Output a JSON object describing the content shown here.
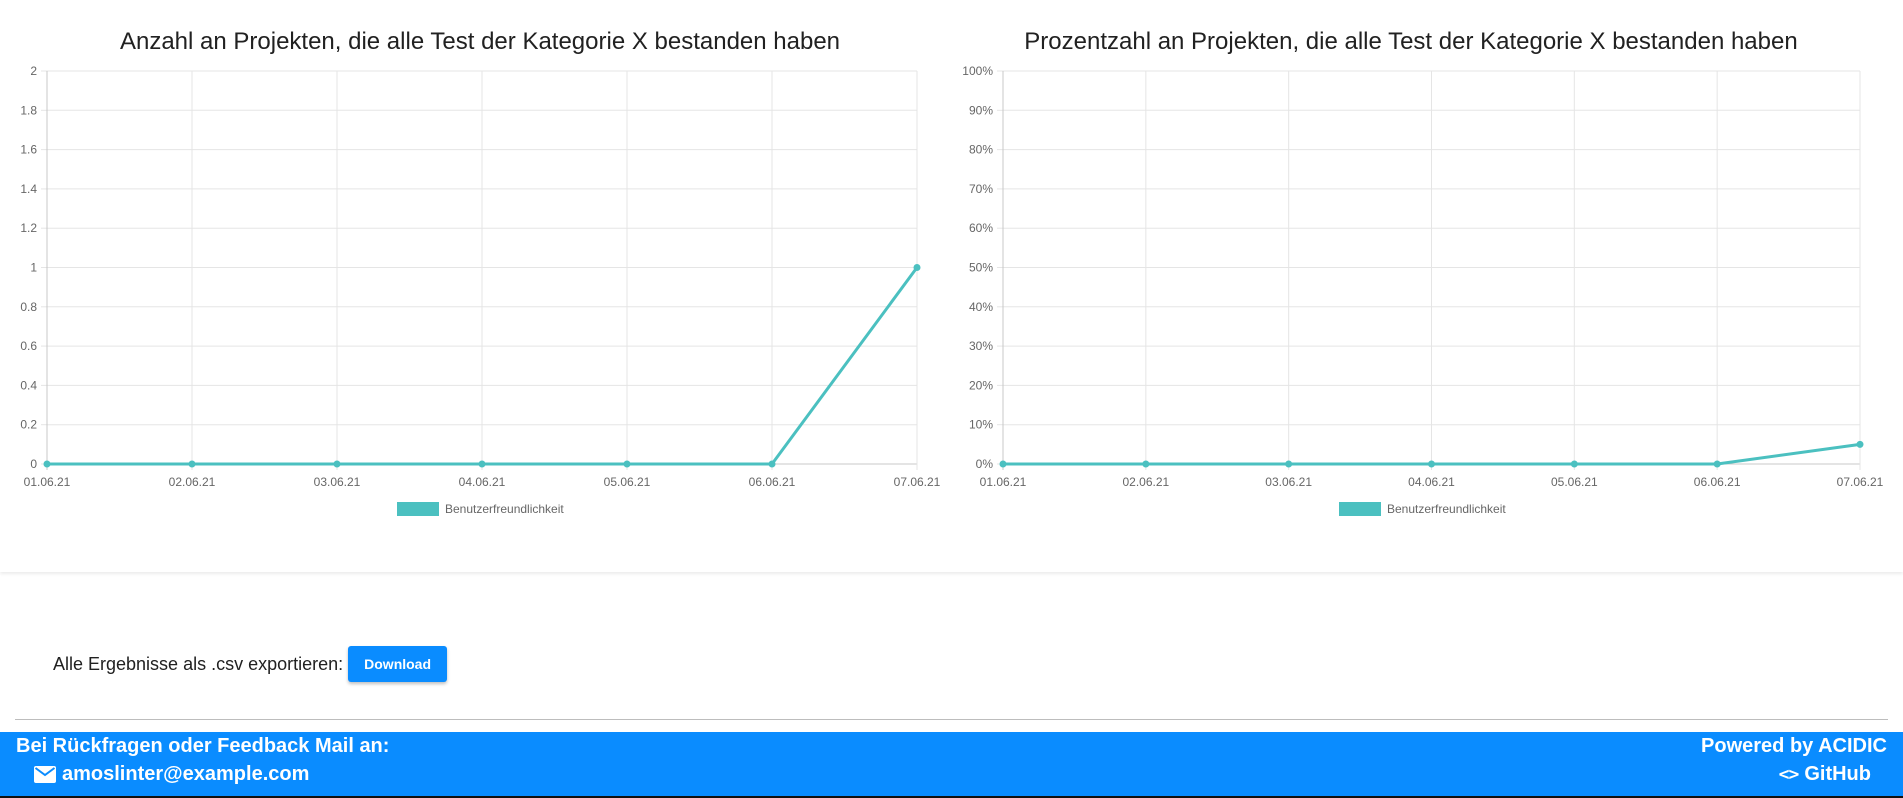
{
  "charts": [
    {
      "title": "Anzahl an Projekten, die alle Test der Kategorie X bestanden haben",
      "legend_label": "Benutzerfreundlichkeit"
    },
    {
      "title": "Prozentzahl an Projekten, die alle Test der Kategorie X bestanden haben",
      "legend_label": "Benutzerfreundlichkeit"
    }
  ],
  "chart_data": [
    {
      "type": "line",
      "title": "Anzahl an Projekten, die alle Test der Kategorie X bestanden haben",
      "x": [
        "01.06.21",
        "02.06.21",
        "03.06.21",
        "04.06.21",
        "05.06.21",
        "06.06.21",
        "07.06.21"
      ],
      "series": [
        {
          "name": "Benutzerfreundlichkeit",
          "values": [
            0,
            0,
            0,
            0,
            0,
            0,
            1
          ],
          "color": "#4bc0c0"
        }
      ],
      "ylim": [
        0,
        2
      ],
      "yticks": [
        "0",
        "0.2",
        "0.4",
        "0.6",
        "0.8",
        "1",
        "1.2",
        "1.4",
        "1.6",
        "1.8",
        "2"
      ],
      "grid": true,
      "legend": "bottom"
    },
    {
      "type": "line",
      "title": "Prozentzahl an Projekten, die alle Test der Kategorie X bestanden haben",
      "x": [
        "01.06.21",
        "02.06.21",
        "03.06.21",
        "04.06.21",
        "05.06.21",
        "06.06.21",
        "07.06.21"
      ],
      "series": [
        {
          "name": "Benutzerfreundlichkeit",
          "values": [
            0,
            0,
            0,
            0,
            0,
            0,
            5
          ],
          "color": "#4bc0c0"
        }
      ],
      "ylim": [
        0,
        100
      ],
      "yticks": [
        "0%",
        "10%",
        "20%",
        "30%",
        "40%",
        "50%",
        "60%",
        "70%",
        "80%",
        "90%",
        "100%"
      ],
      "grid": true,
      "legend": "bottom"
    }
  ],
  "export": {
    "label": "Alle Ergebnisse als .csv exportieren:",
    "button_label": "Download"
  },
  "footer": {
    "feedback_title": "Bei Rückfragen oder Feedback Mail an:",
    "email": "amoslinter@example.com",
    "powered_by": "Powered by ACIDIC",
    "github_label": "GitHub",
    "icons": [
      "mail-icon",
      "code-icon"
    ]
  },
  "colors": {
    "accent": "#0a8cff",
    "series": "#4bc0c0",
    "grid": "#e5e5e5"
  }
}
